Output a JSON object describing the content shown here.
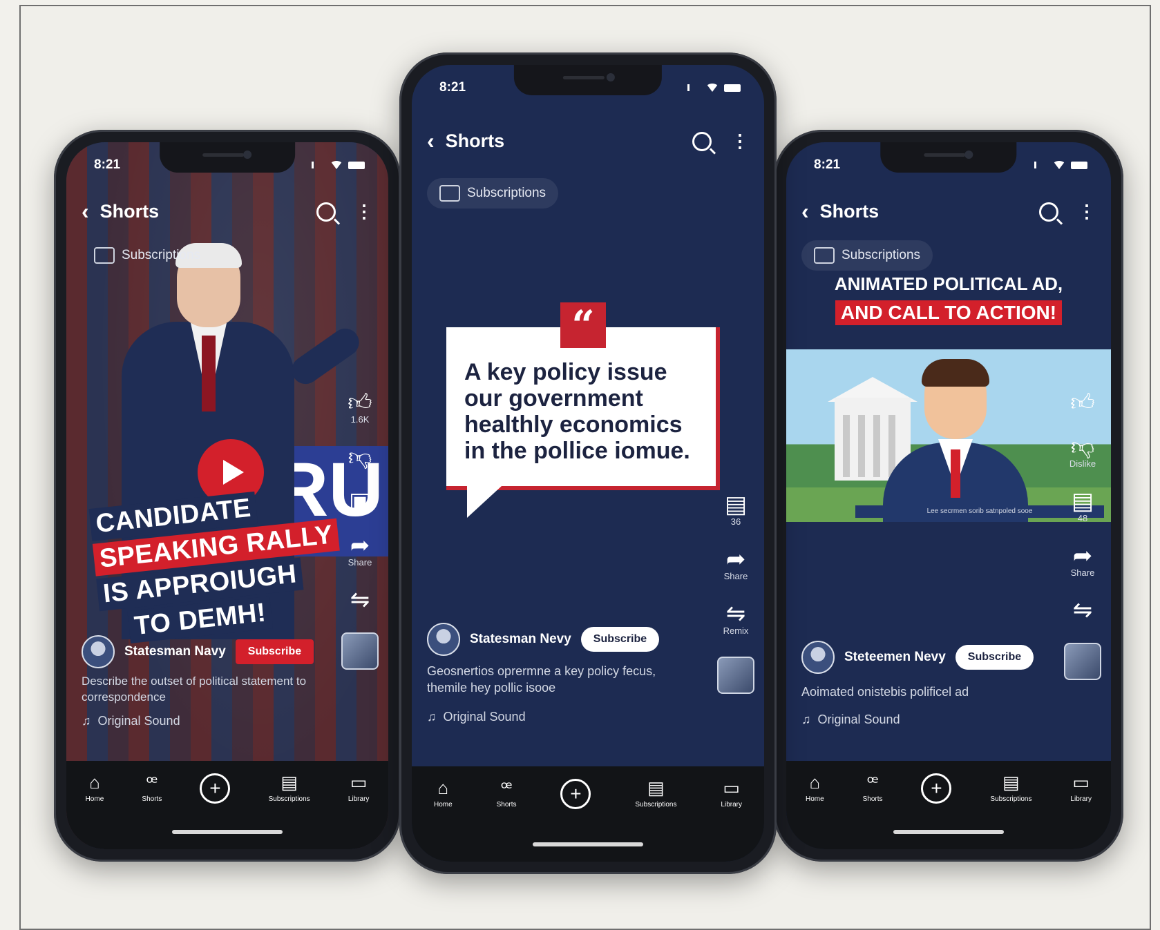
{
  "phones": [
    {
      "status": {
        "time": "8:21"
      },
      "topbar": {
        "back": "‹",
        "title": "Shorts"
      },
      "pill": {
        "label": "Subscriptions"
      },
      "video": {
        "type": "rally",
        "overlay_lines": [
          "CANDIDATE",
          "SPEAKING RALLY",
          "IS APPROIUGH",
          "TO DEMH!"
        ]
      },
      "rail": [
        {
          "icon": "like-icon",
          "label": "1.6K"
        },
        {
          "icon": "dislike-icon",
          "label": ""
        },
        {
          "icon": "comment-icon",
          "label": ""
        },
        {
          "icon": "share-icon",
          "label": "Share"
        },
        {
          "icon": "remix-icon",
          "label": ""
        }
      ],
      "channel": {
        "name": "Statesman Navy",
        "subscribe": "Subscribe"
      },
      "description": "Describe the outset of political statement to correspondence",
      "sound": "Original Sound",
      "nav": [
        "Home",
        "Shorts",
        "",
        "Subscriptions",
        "Library"
      ]
    },
    {
      "status": {
        "time": "8:21"
      },
      "topbar": {
        "back": "‹",
        "title": "Shorts"
      },
      "pill": {
        "label": "Subscriptions"
      },
      "video": {
        "type": "quote",
        "quote_mark": "“",
        "quote_text": "A key policy issue our government healthly economics in the pollice iomue."
      },
      "rail": [
        {
          "icon": "comment-icon",
          "label": "36"
        },
        {
          "icon": "share-icon",
          "label": "Share"
        },
        {
          "icon": "remix-icon",
          "label": "Remix"
        }
      ],
      "channel": {
        "name": "Statesman Nevy",
        "subscribe": "Subscribe"
      },
      "description": "Geosnertios oprermne a key policy fecus, themile hey pollic isooe",
      "sound": "Original Sound",
      "nav": [
        "Home",
        "Shorts",
        "",
        "Subscriptions",
        "Library"
      ]
    },
    {
      "status": {
        "time": "8:21"
      },
      "topbar": {
        "back": "‹",
        "title": "Shorts"
      },
      "pill": {
        "label": "Subscriptions"
      },
      "video": {
        "type": "animated",
        "headline_1": "ANIMATED POLITICAL AD,",
        "headline_2": "AND CALL TO ACTION!",
        "caption": "Lee secrmen sorib satnpoled sooe"
      },
      "rail": [
        {
          "icon": "like-icon",
          "label": ""
        },
        {
          "icon": "dislike-icon",
          "label": "Dislike"
        },
        {
          "icon": "comment-icon",
          "label": "48"
        },
        {
          "icon": "share-icon",
          "label": "Share"
        },
        {
          "icon": "remix-icon",
          "label": ""
        }
      ],
      "channel": {
        "name": "Steteemen Nevy",
        "subscribe": "Subscribe"
      },
      "description": "Aoimated onistebis polificel ad",
      "sound": "Original Sound",
      "nav": [
        "Home",
        "Shorts",
        "",
        "Subscriptions",
        "Library"
      ]
    }
  ]
}
